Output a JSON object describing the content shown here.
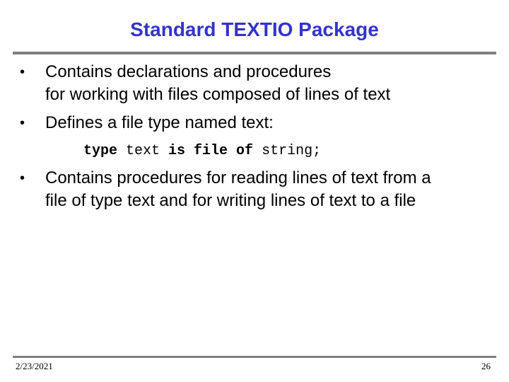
{
  "slide": {
    "title": "Standard TEXTIO Package",
    "title_color": "#3333cc",
    "bullets": [
      {
        "icon": "bullet-dot",
        "lines": [
          "Contains declarations and procedures",
          "for working with files composed of lines of text"
        ]
      },
      {
        "icon": "bullet-dot",
        "lines": [
          "Defines a file type named text:"
        ]
      },
      {
        "icon": "bullet-dot",
        "lines": [
          "Contains procedures for reading lines of text from a",
          "file of type text and for writing lines of text to a file"
        ]
      }
    ],
    "code": {
      "tokens": [
        {
          "text": "type",
          "bold": true
        },
        {
          "text": " text ",
          "bold": false
        },
        {
          "text": "is file of",
          "bold": true
        },
        {
          "text": " string;",
          "bold": false
        }
      ]
    },
    "footer": {
      "date": "2/23/2021",
      "page_number": "26"
    }
  }
}
